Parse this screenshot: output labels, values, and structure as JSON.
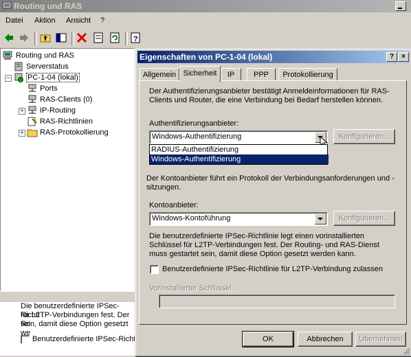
{
  "window": {
    "title": "Routing und RAS"
  },
  "menu": {
    "items": [
      "Datei",
      "Aktion",
      "Ansicht",
      "?"
    ]
  },
  "tree": {
    "root": "Routing und RAS",
    "items": [
      {
        "label": "Serverstatus"
      },
      {
        "label": "PC-1-04 (lokal)"
      },
      {
        "label": "Ports"
      },
      {
        "label": "RAS-Clients (0)"
      },
      {
        "label": "IP-Routing"
      },
      {
        "label": "RAS-Richtlinien"
      },
      {
        "label": "RAS-Protokollierung"
      }
    ]
  },
  "background_panel": {
    "line1": "Die benutzerdefinierte IPSec-Richtl",
    "line2": "für L2TP-Verbindungen fest. Der Ro",
    "line3": "sein, damit diese Option gesetzt we",
    "checkbox_label": "Benutzerdefinierte IPSec-Richtl"
  },
  "dialog": {
    "title": "Eigenschaften von PC-1-04 (lokal)",
    "help_button": "?",
    "close_button": "×",
    "tabs": [
      "Allgemein",
      "Sicherheit",
      "IP",
      "PPP",
      "Protokollierung"
    ],
    "active_tab": "Sicherheit",
    "auth_description": "Der Authentifizierungsanbieter bestätigt Anmeldeinformationen für RAS-Clients und Router, die eine Verbindung bei Bedarf herstellen können.",
    "auth_label": "Authentifizierungsanbieter:",
    "auth_value": "Windows-Authentifizierung",
    "auth_options": [
      "RADIUS-Authentifizierung",
      "Windows-Authentifizierung"
    ],
    "configure_label": "Konfigurieren...",
    "account_description": "Der Kontoanbieter führt ein Protokoll der Verbindungsanforderungen und -sitzungen.",
    "account_label": "Kontoanbieter:",
    "account_value": "Windows-Kontoführung",
    "ipsec_description": "Die benutzerdefinierte IPSec-Richtlinie legt einen vorinstallierten Schlüssel für L2TP-Verbindungen fest. Der Routing- und RAS-Dienst muss gestartet sein, damit diese Option gesetzt werden kann.",
    "ipsec_checkbox_label": "Benutzerdefinierte IPSec-Richtlinie für L2TP-Verbindung zulassen",
    "psk_label": "Vorinstallierter Schlüssel:",
    "psk_value": "",
    "buttons": {
      "ok": "OK",
      "cancel": "Abbrechen",
      "apply": "Übernehmen"
    }
  }
}
